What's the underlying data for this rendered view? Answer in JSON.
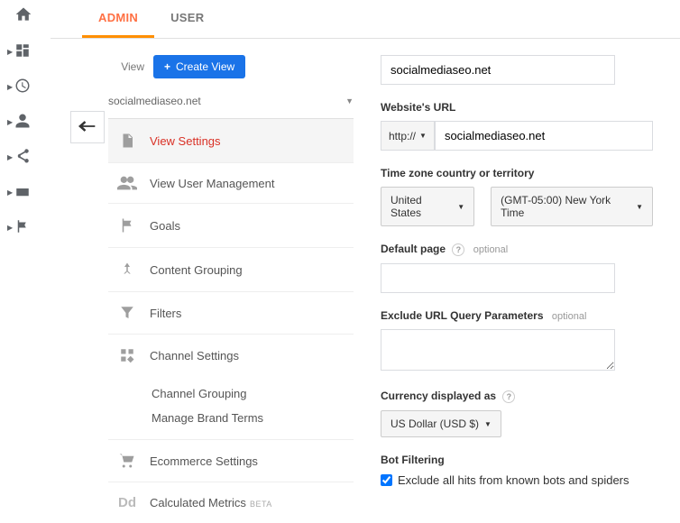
{
  "tabs": {
    "admin": "ADMIN",
    "user": "USER"
  },
  "view": {
    "label": "View",
    "create": "Create View",
    "selector": "socialmediaseo.net"
  },
  "nav": {
    "settings": "View Settings",
    "users": "View User Management",
    "goals": "Goals",
    "content": "Content Grouping",
    "filters": "Filters",
    "channel": "Channel Settings",
    "channel_sub1": "Channel Grouping",
    "channel_sub2": "Manage Brand Terms",
    "ecommerce": "Ecommerce Settings",
    "calc": "Calculated Metrics",
    "beta": "BETA"
  },
  "form": {
    "view_name_value": "socialmediaseo.net",
    "url_label": "Website's URL",
    "protocol": "http://",
    "url_value": "socialmediaseo.net",
    "tz_label": "Time zone country or territory",
    "tz_country": "United States",
    "tz_value": "(GMT-05:00) New York Time",
    "default_label": "Default page",
    "default_value": "",
    "optional": "optional",
    "exclude_label": "Exclude URL Query Parameters",
    "exclude_value": "",
    "currency_label": "Currency displayed as",
    "currency_value": "US Dollar (USD $)",
    "bot_label": "Bot Filtering",
    "bot_check": "Exclude all hits from known bots and spiders"
  }
}
